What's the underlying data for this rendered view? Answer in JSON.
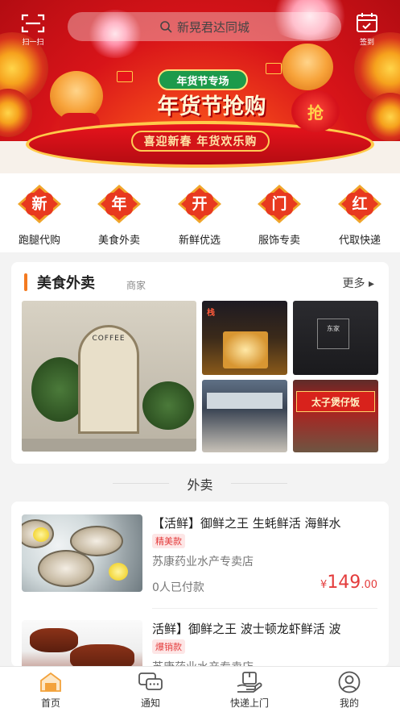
{
  "topbar": {
    "scan_label": "扫一扫",
    "search_placeholder": "新晃君达同城",
    "signin_label": "签到"
  },
  "banner": {
    "pill": "年货节专场",
    "headline": "年货节抢购",
    "lantern": "抢",
    "slogan": "喜迎新春 年货欢乐购"
  },
  "categories": [
    {
      "badge": "新",
      "label": "跑腿代购"
    },
    {
      "badge": "年",
      "label": "美食外卖"
    },
    {
      "badge": "开",
      "label": "新鲜优选"
    },
    {
      "badge": "门",
      "label": "服饰专卖"
    },
    {
      "badge": "红",
      "label": "代取快递"
    }
  ],
  "food_section": {
    "title": "美食外卖",
    "subtitle": "商家",
    "more": "更多 ▸",
    "photos": {
      "main_sign": "COFFEE",
      "shop1_sign": "栈",
      "shop2_sign": "东家",
      "shop4_sign": "太子煲仔饭"
    }
  },
  "takeout_title": "外卖",
  "products": [
    {
      "name": "【活鲜】御鲜之王 生蚝鲜活 海鲜水",
      "tag": "精美款",
      "shop": "苏康药业水产专卖店",
      "sold": "0人已付款",
      "price_symbol": "¥",
      "price_int": "149",
      "price_dec": ".00"
    },
    {
      "name": "活鲜】御鲜之王 波士顿龙虾鲜活 波",
      "tag": "爆销款",
      "shop": "苏康药业水产专卖店"
    }
  ],
  "bottom_nav": [
    {
      "label": "首页",
      "icon": "home-icon",
      "active": true
    },
    {
      "label": "通知",
      "icon": "chat-icon",
      "active": false
    },
    {
      "label": "快递上门",
      "icon": "delivery-icon",
      "active": false
    },
    {
      "label": "我的",
      "icon": "user-icon",
      "active": false
    }
  ],
  "colors": {
    "accent": "#f47a20",
    "banner_red": "#d81419",
    "price_red": "#e43c3c",
    "badge_red": "#e8391f"
  }
}
